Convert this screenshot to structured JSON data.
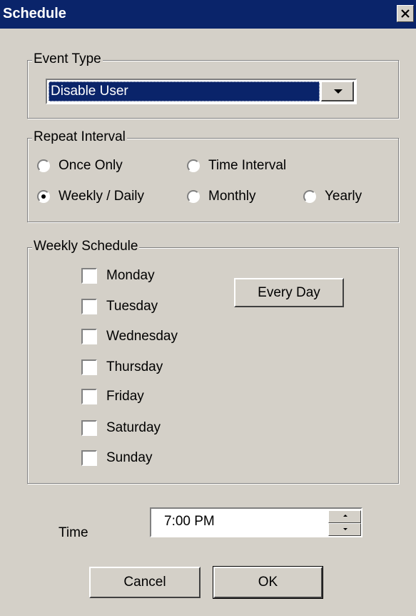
{
  "window": {
    "title": "Schedule",
    "close_icon": "close-icon"
  },
  "event_type": {
    "legend": "Event Type",
    "selected": "Disable User"
  },
  "repeat_interval": {
    "legend": "Repeat Interval",
    "options": [
      {
        "label": "Once Only",
        "selected": false
      },
      {
        "label": "Time Interval",
        "selected": false
      },
      {
        "label": "Weekly / Daily",
        "selected": true
      },
      {
        "label": "Monthly",
        "selected": false
      },
      {
        "label": "Yearly",
        "selected": false
      }
    ]
  },
  "weekly_schedule": {
    "legend": "Weekly Schedule",
    "days": [
      {
        "label": "Monday",
        "checked": false
      },
      {
        "label": "Tuesday",
        "checked": false
      },
      {
        "label": "Wednesday",
        "checked": false
      },
      {
        "label": "Thursday",
        "checked": false
      },
      {
        "label": "Friday",
        "checked": false
      },
      {
        "label": "Saturday",
        "checked": false
      },
      {
        "label": "Sunday",
        "checked": false
      }
    ],
    "every_day_label": "Every Day"
  },
  "time": {
    "label": "Time",
    "value": "7:00 PM"
  },
  "buttons": {
    "cancel": "Cancel",
    "ok": "OK"
  },
  "colors": {
    "titlebar": "#0a246a",
    "face": "#d4d0c8",
    "selection": "#0a246a"
  }
}
